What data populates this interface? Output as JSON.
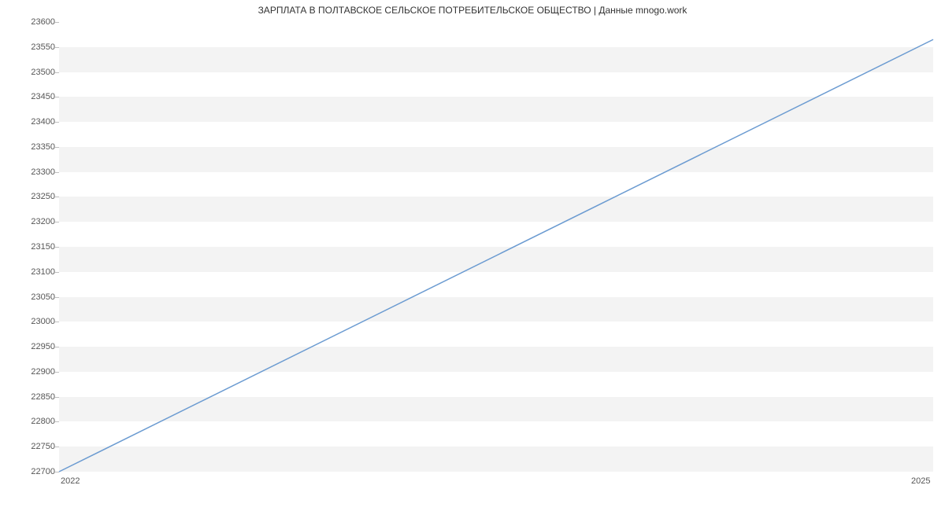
{
  "chart_data": {
    "type": "line",
    "title": "ЗАРПЛАТА В ПОЛТАВСКОЕ СЕЛЬСКОЕ ПОТРЕБИТЕЛЬСКОЕ ОБЩЕСТВО | Данные mnogo.work",
    "xlabel": "",
    "ylabel": "",
    "x_categories": [
      "2022",
      "2025"
    ],
    "x": [
      2022,
      2025
    ],
    "values": [
      22700,
      23565
    ],
    "xlim": [
      2022,
      2025
    ],
    "ylim": [
      22700,
      23600
    ],
    "y_ticks": [
      22700,
      22750,
      22800,
      22850,
      22900,
      22950,
      23000,
      23050,
      23100,
      23150,
      23200,
      23250,
      23300,
      23350,
      23400,
      23450,
      23500,
      23550,
      23600
    ],
    "line_color": "#6b9bd1",
    "band_color": "#f3f3f3"
  }
}
